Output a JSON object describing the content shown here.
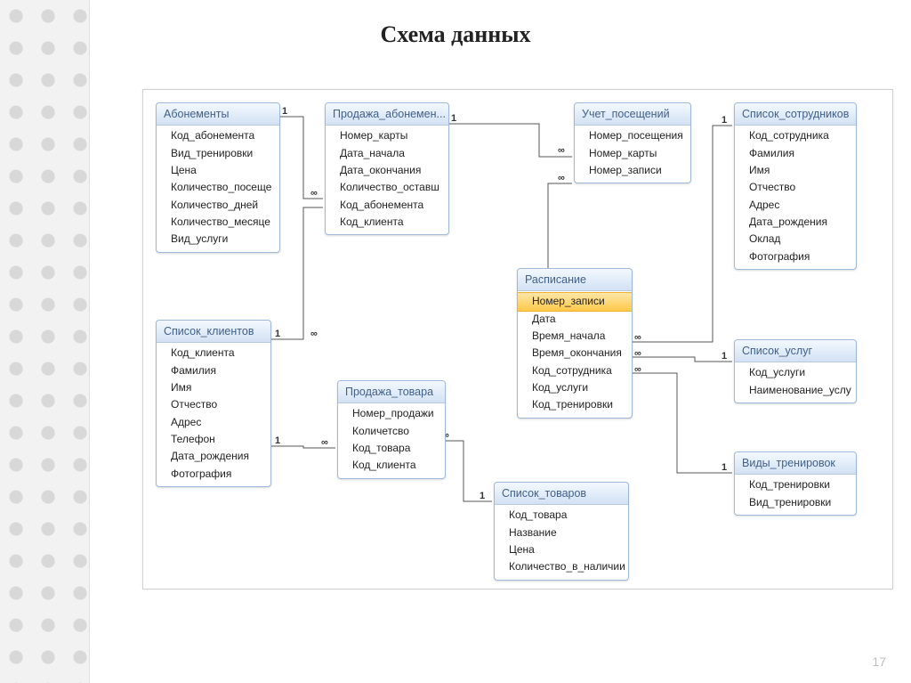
{
  "pageTitle": "Схема данных",
  "slideNumber": "17",
  "relationLabels": {
    "one": "1",
    "many": "∞"
  },
  "tables": {
    "abonements": {
      "title": "Абонементы",
      "fields": [
        "Код_абонемента",
        "Вид_тренировки",
        "Цена",
        "Количество_посеще",
        "Количество_дней",
        "Количество_месяце",
        "Вид_услуги"
      ]
    },
    "sale_abon": {
      "title": "Продажа_абонемен...",
      "fields": [
        "Номер_карты",
        "Дата_начала",
        "Дата_окончания",
        "Количество_оставш",
        "Код_абонемента",
        "Код_клиента"
      ]
    },
    "visits": {
      "title": "Учет_посещений",
      "fields": [
        "Номер_посещения",
        "Номер_карты",
        "Номер_записи"
      ]
    },
    "staff": {
      "title": "Список_сотрудников",
      "fields": [
        "Код_сотрудника",
        "Фамилия",
        "Имя",
        "Отчество",
        "Адрес",
        "Дата_рождения",
        "Оклад",
        "Фотография"
      ]
    },
    "clients": {
      "title": "Список_клиентов",
      "fields": [
        "Код_клиента",
        "Фамилия",
        "Имя",
        "Отчество",
        "Адрес",
        "Телефон",
        "Дата_рождения",
        "Фотография"
      ]
    },
    "sale_goods": {
      "title": "Продажа_товара",
      "fields": [
        "Номер_продажи",
        "Количетсво",
        "Код_товара",
        "Код_клиента"
      ]
    },
    "schedule": {
      "title": "Расписание",
      "selected": "Номер_записи",
      "fields": [
        "Номер_записи",
        "Дата",
        "Время_начала",
        "Время_окончания",
        "Код_сотрудника",
        "Код_услуги",
        "Код_тренировки"
      ]
    },
    "services": {
      "title": "Список_услуг",
      "fields": [
        "Код_услуги",
        "Наименование_услу"
      ]
    },
    "training": {
      "title": "Виды_тренировок",
      "fields": [
        "Код_тренировки",
        "Вид_тренировки"
      ]
    },
    "goods": {
      "title": "Список_товаров",
      "fields": [
        "Код_товара",
        "Название",
        "Цена",
        "Количество_в_наличии"
      ]
    }
  }
}
